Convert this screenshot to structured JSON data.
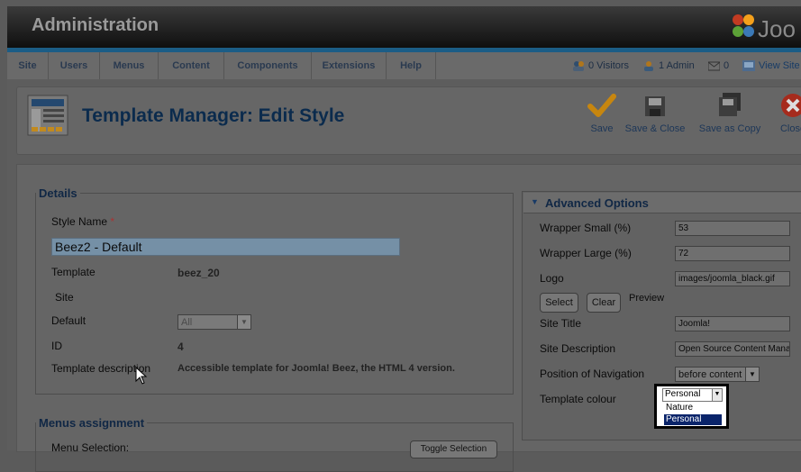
{
  "header": {
    "title": "Administration",
    "brand": "Joomla!"
  },
  "menu": [
    "Site",
    "Users",
    "Menus",
    "Content",
    "Components",
    "Extensions",
    "Help"
  ],
  "status": {
    "visitors": "0 Visitors",
    "admin": "1 Admin",
    "messages": "0",
    "view_site": "View Site"
  },
  "toolbar": {
    "title": "Template Manager: Edit Style",
    "save": "Save",
    "save_close": "Save & Close",
    "save_copy": "Save as Copy",
    "close": "Close"
  },
  "details": {
    "legend": "Details",
    "style_name_label": "Style Name",
    "required": "*",
    "style_name_value": "Beez2 - Default",
    "template_label": "Template",
    "template_value": "beez_20",
    "site_label": "Site",
    "default_label": "Default",
    "default_value": "All",
    "id_label": "ID",
    "id_value": "4",
    "desc_label": "Template description",
    "desc_value": "Accessible template for Joomla! Beez, the HTML 4 version."
  },
  "menus_assignment": {
    "legend": "Menus assignment",
    "menu_selection_label": "Menu Selection:",
    "toggle_button": "Toggle Selection"
  },
  "advanced": {
    "title": "Advanced Options",
    "wrapper_small_label": "Wrapper Small (%)",
    "wrapper_small_value": "53",
    "wrapper_large_label": "Wrapper Large (%)",
    "wrapper_large_value": "72",
    "logo_label": "Logo",
    "logo_value": "images/joomla_black.gif",
    "select_btn": "Select",
    "clear_btn": "Clear",
    "preview_label": "Preview",
    "site_title_label": "Site Title",
    "site_title_value": "Joomla!",
    "site_desc_label": "Site Description",
    "site_desc_value": "Open Source Content Management",
    "nav_pos_label": "Position of Navigation",
    "nav_pos_value": "before content",
    "colour_label": "Template colour",
    "colour_selected": "Personal",
    "colour_options": [
      "Nature",
      "Personal"
    ]
  }
}
